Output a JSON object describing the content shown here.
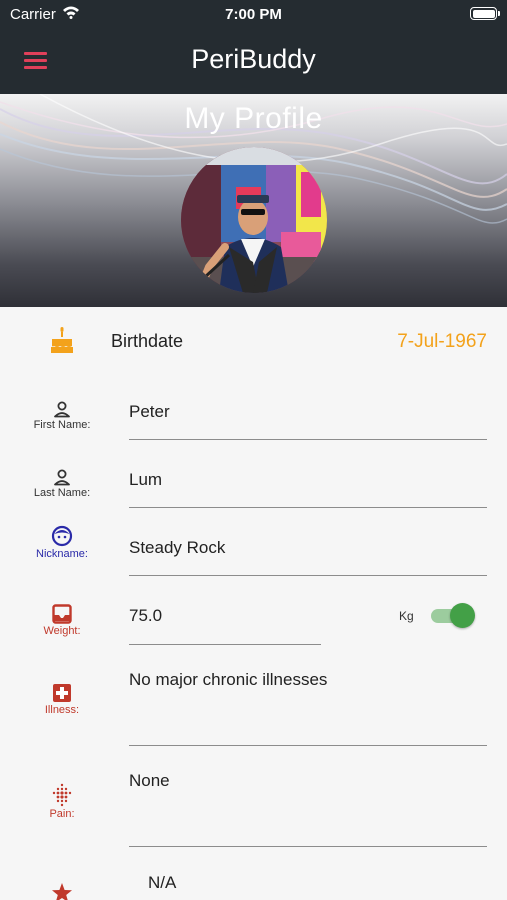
{
  "status_bar": {
    "carrier": "Carrier",
    "time": "7:00 PM"
  },
  "app_bar": {
    "title": "PeriBuddy",
    "menu_icon": "hamburger-menu-icon"
  },
  "profile_header": {
    "title": "My Profile"
  },
  "birthdate": {
    "label": "Birthdate",
    "value": "7-Jul-1967",
    "icon": "cake-icon",
    "color": "#f3a21b"
  },
  "fields": {
    "first_name": {
      "label": "First Name:",
      "value": "Peter",
      "icon": "person-icon"
    },
    "last_name": {
      "label": "Last Name:",
      "value": "Lum",
      "icon": "person-icon"
    },
    "nickname": {
      "label": "Nickname:",
      "value": "Steady Rock",
      "icon": "face-icon",
      "color": "#2a2aa8"
    },
    "weight": {
      "label": "Weight:",
      "value": "75.0",
      "unit": "Kg",
      "unit_toggle_on": true,
      "icon": "scale-icon",
      "color": "#c0392b"
    },
    "illness": {
      "label": "Illness:",
      "value": "No major chronic illnesses",
      "icon": "medical-cross-icon",
      "color": "#c0392b"
    },
    "pain": {
      "label": "Pain:",
      "value": "None",
      "icon": "pain-dots-icon",
      "color": "#c0392b"
    },
    "last": {
      "value": "N/A",
      "icon": "star-icon",
      "color": "#c0392b"
    }
  }
}
